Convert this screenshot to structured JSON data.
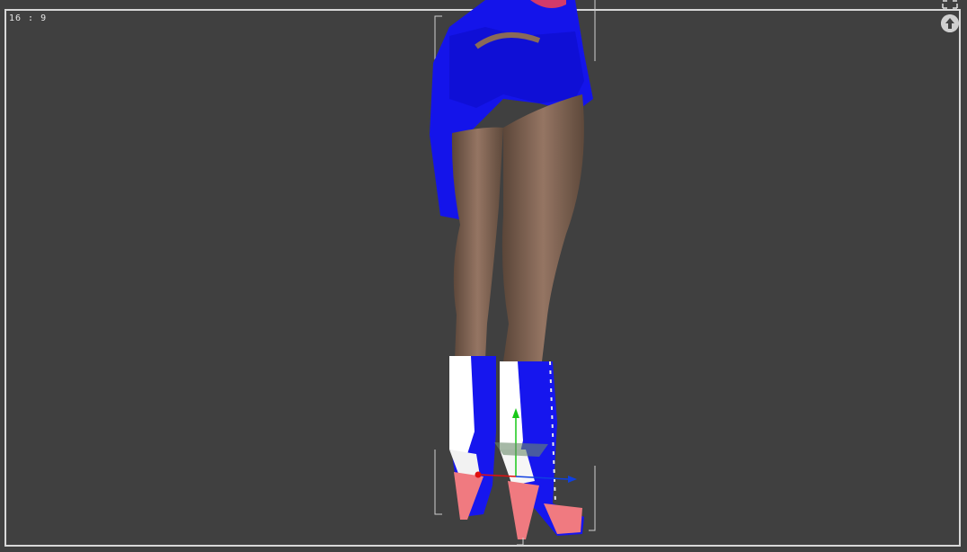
{
  "viewport": {
    "aspect_label": "16 : 9",
    "background_color": "#404040",
    "frame_color": "#d8d8d8"
  },
  "icons": {
    "maximize": "maximize-icon",
    "camera_up": "up-arrow-icon"
  },
  "figure": {
    "outfit_color": "#1a1aee",
    "skin_color": "#8a6a55",
    "heel_color": "#f07a80",
    "boot_panel_color": "#ffffff"
  },
  "gizmo": {
    "x_axis_color": "#e01010",
    "y_axis_color": "#18c818",
    "z_axis_color": "#1040e0"
  }
}
